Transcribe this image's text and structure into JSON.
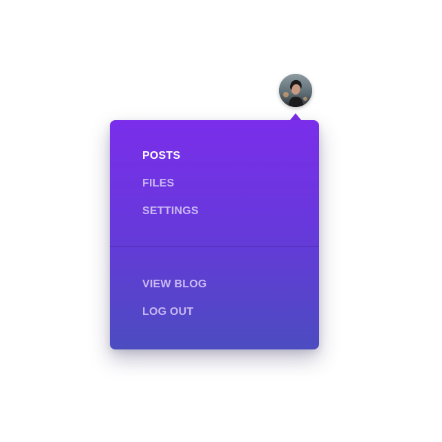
{
  "profile": {
    "avatar_icon": "user-avatar-photo"
  },
  "menu": {
    "primary_items": [
      {
        "label": "POSTS",
        "active": true
      },
      {
        "label": "FILES",
        "active": false
      },
      {
        "label": "SETTINGS",
        "active": false
      }
    ],
    "secondary_items": [
      {
        "label": "VIEW BLOG",
        "active": false
      },
      {
        "label": "LOG OUT",
        "active": false
      }
    ]
  },
  "colors": {
    "gradient_top": "#7a2eea",
    "gradient_bottom": "#4c4cc0",
    "active_text": "#ffffff",
    "inactive_text": "#c9b8f2"
  }
}
